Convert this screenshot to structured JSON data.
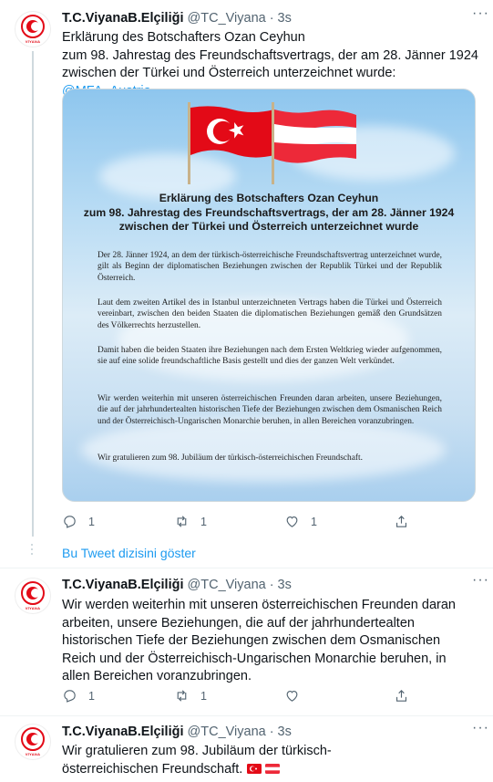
{
  "tweets": [
    {
      "name": "T.C.ViyanaB.Elçiliği",
      "handle": "@TC_Viyana",
      "dot": "·",
      "time": "3s",
      "avatar_caption": "VİYANA",
      "text_lines": [
        "Erklärung des Botschafters Ozan Ceyhun",
        "zum 98. Jahrestag des Freundschaftsvertrags, der am 28. Jänner 1924",
        "zwischen der Türkei und Österreich unterzeichnet wurde: "
      ],
      "mention": "@MFA_Austria",
      "replies": "1",
      "retweets": "1",
      "likes": "1"
    },
    {
      "name": "T.C.ViyanaB.Elçiliği",
      "handle": "@TC_Viyana",
      "dot": "·",
      "time": "3s",
      "avatar_caption": "VİYANA",
      "text": "Wir werden weiterhin mit unseren österreichischen Freunden daran arbeiten, unsere Beziehungen, die auf der jahrhundertealten historischen Tiefe der Beziehungen zwischen dem Osmanischen Reich und der Österreichisch-Ungarischen Monarchie beruhen, in allen Bereichen voranzubringen.",
      "replies": "1",
      "retweets": "1",
      "likes": ""
    },
    {
      "name": "T.C.ViyanaB.Elçiliği",
      "handle": "@TC_Viyana",
      "dot": "·",
      "time": "3s",
      "avatar_caption": "VİYANA",
      "text": "Wir gratulieren zum 98. Jubiläum der türkisch-österreichischen Freundschaft."
    }
  ],
  "show_thread": "Bu Tweet dizisini göster",
  "image": {
    "title_lines": [
      "Erklärung des Botschafters Ozan Ceyhun",
      "zum 98. Jahrestag des Freundschaftsvertrags, der am 28. Jänner 1924",
      "zwischen der Türkei und Österreich unterzeichnet wurde"
    ],
    "paragraphs": [
      "Der 28. Jänner 1924, an dem der türkisch-österreichische Freundschaftsvertrag unterzeichnet wurde, gilt als Beginn der diplomatischen Beziehungen zwischen der Republik Türkei und der Republik Österreich.",
      "Laut dem zweiten Artikel des in Istanbul unterzeichneten Vertrags haben die Türkei und Österreich vereinbart, zwischen den beiden Staaten die diplomatischen Beziehungen gemäß den Grundsätzen des Völkerrechts herzustellen.",
      "Damit haben die beiden Staaten ihre Beziehungen nach dem Ersten Weltkrieg wieder aufgenommen, sie auf eine solide freundschaftliche Basis gestellt und dies der ganzen Welt verkündet.",
      "Wir werden weiterhin mit unseren österreichischen Freunden daran arbeiten, unsere Beziehungen, die auf der jahrhundertealten historischen Tiefe der Beziehungen zwischen dem Osmanischen Reich und der Österreichisch-Ungarischen Monarchie beruhen, in allen Bereichen voranzubringen.",
      "Wir gratulieren zum 98. Jubiläum der türkisch-österreichischen Freundschaft."
    ]
  },
  "colors": {
    "link": "#1d9bf0",
    "turkey_red": "#e30a17",
    "austria_red": "#ed2939",
    "muted": "#536471"
  },
  "icons": [
    "reply-icon",
    "retweet-icon",
    "like-icon",
    "share-icon",
    "more-icon",
    "flag-turkey-icon",
    "flag-austria-icon"
  ]
}
